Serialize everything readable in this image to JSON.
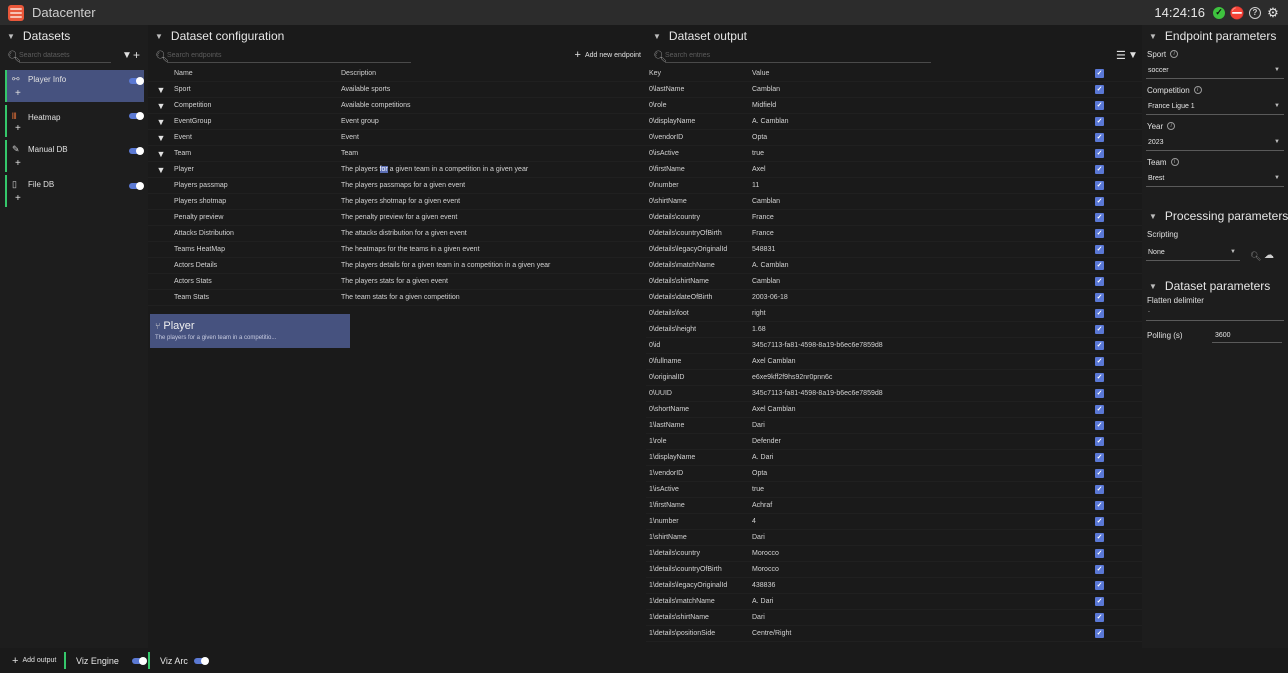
{
  "app": {
    "title": "Datacenter",
    "clock": "14:24:16"
  },
  "datasets": {
    "header": "Datasets",
    "search_placeholder": "Search datasets",
    "items": [
      {
        "label": "Player Info",
        "icon": "link-icon",
        "active": true
      },
      {
        "label": "Heatmap",
        "icon": "heatmap-icon",
        "active": false
      },
      {
        "label": "Manual DB",
        "icon": "edit-icon",
        "active": false
      },
      {
        "label": "File DB",
        "icon": "file-icon",
        "active": false
      }
    ],
    "plus": "+"
  },
  "config": {
    "header": "Dataset configuration",
    "search_placeholder": "Search endpoints",
    "add_label": "Add new endpoint",
    "columns": {
      "name": "Name",
      "description": "Description"
    },
    "rows": [
      {
        "name": "Sport",
        "description": "Available sports",
        "filter": true
      },
      {
        "name": "Competition",
        "description": "Available competitions",
        "filter": true
      },
      {
        "name": "EventGroup",
        "description": "Event group",
        "filter": true
      },
      {
        "name": "Event",
        "description": "Event",
        "filter": true
      },
      {
        "name": "Team",
        "description": "Team",
        "filter": true
      },
      {
        "name": "Player",
        "description_pre": "The players ",
        "description_hl": "for",
        "description_post": " a given team in a competition in a given year",
        "filter": true
      },
      {
        "name": "Players passmap",
        "description": "The players passmaps for a given event",
        "filter": false
      },
      {
        "name": "Players shotmap",
        "description": "The players shotmap for a given event",
        "filter": false
      },
      {
        "name": "Penalty preview",
        "description": "The penalty preview for a given event",
        "filter": false
      },
      {
        "name": "Attacks Distribution",
        "description": "The attacks distribution for a given event",
        "filter": false
      },
      {
        "name": "Teams HeatMap",
        "description": "The heatmaps for the teams in a given event",
        "filter": false
      },
      {
        "name": "Actors Details",
        "description": "The players details for a given team in a competition in a given year",
        "filter": false
      },
      {
        "name": "Actors Stats",
        "description": "The players stats for a given event",
        "filter": false
      },
      {
        "name": "Team Stats",
        "description": "The team stats for a given competition",
        "filter": false
      }
    ],
    "card": {
      "title": "Player",
      "subtitle": "The players for a given team in a competitio..."
    }
  },
  "output": {
    "header": "Dataset output",
    "search_placeholder": "Search entries",
    "columns": {
      "key": "Key",
      "value": "Value"
    },
    "rows": [
      {
        "key": "0\\lastName",
        "value": "Camblan"
      },
      {
        "key": "0\\role",
        "value": "Midfield"
      },
      {
        "key": "0\\displayName",
        "value": "A. Camblan"
      },
      {
        "key": "0\\vendorID",
        "value": "Opta"
      },
      {
        "key": "0\\isActive",
        "value": "true"
      },
      {
        "key": "0\\firstName",
        "value": "Axel"
      },
      {
        "key": "0\\number",
        "value": "11"
      },
      {
        "key": "0\\shirtName",
        "value": "Camblan"
      },
      {
        "key": "0\\details\\country",
        "value": "France"
      },
      {
        "key": "0\\details\\countryOfBirth",
        "value": "France"
      },
      {
        "key": "0\\details\\legacyOriginalId",
        "value": "548831"
      },
      {
        "key": "0\\details\\matchName",
        "value": "A. Camblan"
      },
      {
        "key": "0\\details\\shirtName",
        "value": "Camblan"
      },
      {
        "key": "0\\details\\dateOfBirth",
        "value": "2003-06-18"
      },
      {
        "key": "0\\details\\foot",
        "value": "right"
      },
      {
        "key": "0\\details\\height",
        "value": "1.68"
      },
      {
        "key": "0\\id",
        "value": "345c7113-fa81-4598-8a19-b6ec6e7859d8"
      },
      {
        "key": "0\\fullname",
        "value": "Axel Camblan"
      },
      {
        "key": "0\\originalID",
        "value": "e6xe9kff2f9hs92nr0pnn6c"
      },
      {
        "key": "0\\UUID",
        "value": "345c7113-fa81-4598-8a19-b6ec6e7859d8"
      },
      {
        "key": "0\\shortName",
        "value": "Axel Camblan"
      },
      {
        "key": "1\\lastName",
        "value": "Dari"
      },
      {
        "key": "1\\role",
        "value": "Defender"
      },
      {
        "key": "1\\displayName",
        "value": "A. Dari"
      },
      {
        "key": "1\\vendorID",
        "value": "Opta"
      },
      {
        "key": "1\\isActive",
        "value": "true"
      },
      {
        "key": "1\\firstName",
        "value": "Achraf"
      },
      {
        "key": "1\\number",
        "value": "4"
      },
      {
        "key": "1\\shirtName",
        "value": "Dari"
      },
      {
        "key": "1\\details\\country",
        "value": "Morocco"
      },
      {
        "key": "1\\details\\countryOfBirth",
        "value": "Morocco"
      },
      {
        "key": "1\\details\\legacyOriginalId",
        "value": "438836"
      },
      {
        "key": "1\\details\\matchName",
        "value": "A. Dari"
      },
      {
        "key": "1\\details\\shirtName",
        "value": "Dari"
      },
      {
        "key": "1\\details\\positionSide",
        "value": "Centre/Right"
      }
    ]
  },
  "params": {
    "endpoint_header": "Endpoint parameters",
    "sport": {
      "label": "Sport",
      "value": "soccer"
    },
    "competition": {
      "label": "Competition",
      "value": "France Ligue 1"
    },
    "year": {
      "label": "Year",
      "value": "2023"
    },
    "team": {
      "label": "Team",
      "value": "Brest"
    },
    "processing_header": "Processing parameters",
    "scripting": {
      "label": "Scripting",
      "value": "None"
    },
    "dataset_header": "Dataset parameters",
    "flatten": {
      "label": "Flatten delimiter",
      "value": "."
    },
    "polling": {
      "label": "Polling (s)",
      "value": "3600"
    }
  },
  "footer": {
    "add_output": "Add output",
    "outputs": [
      {
        "label": "Viz Engine"
      },
      {
        "label": "Viz Arc"
      }
    ]
  },
  "colors": {
    "accent": "#5a78d6",
    "active_bg": "#46527f",
    "green": "#35c76b"
  }
}
